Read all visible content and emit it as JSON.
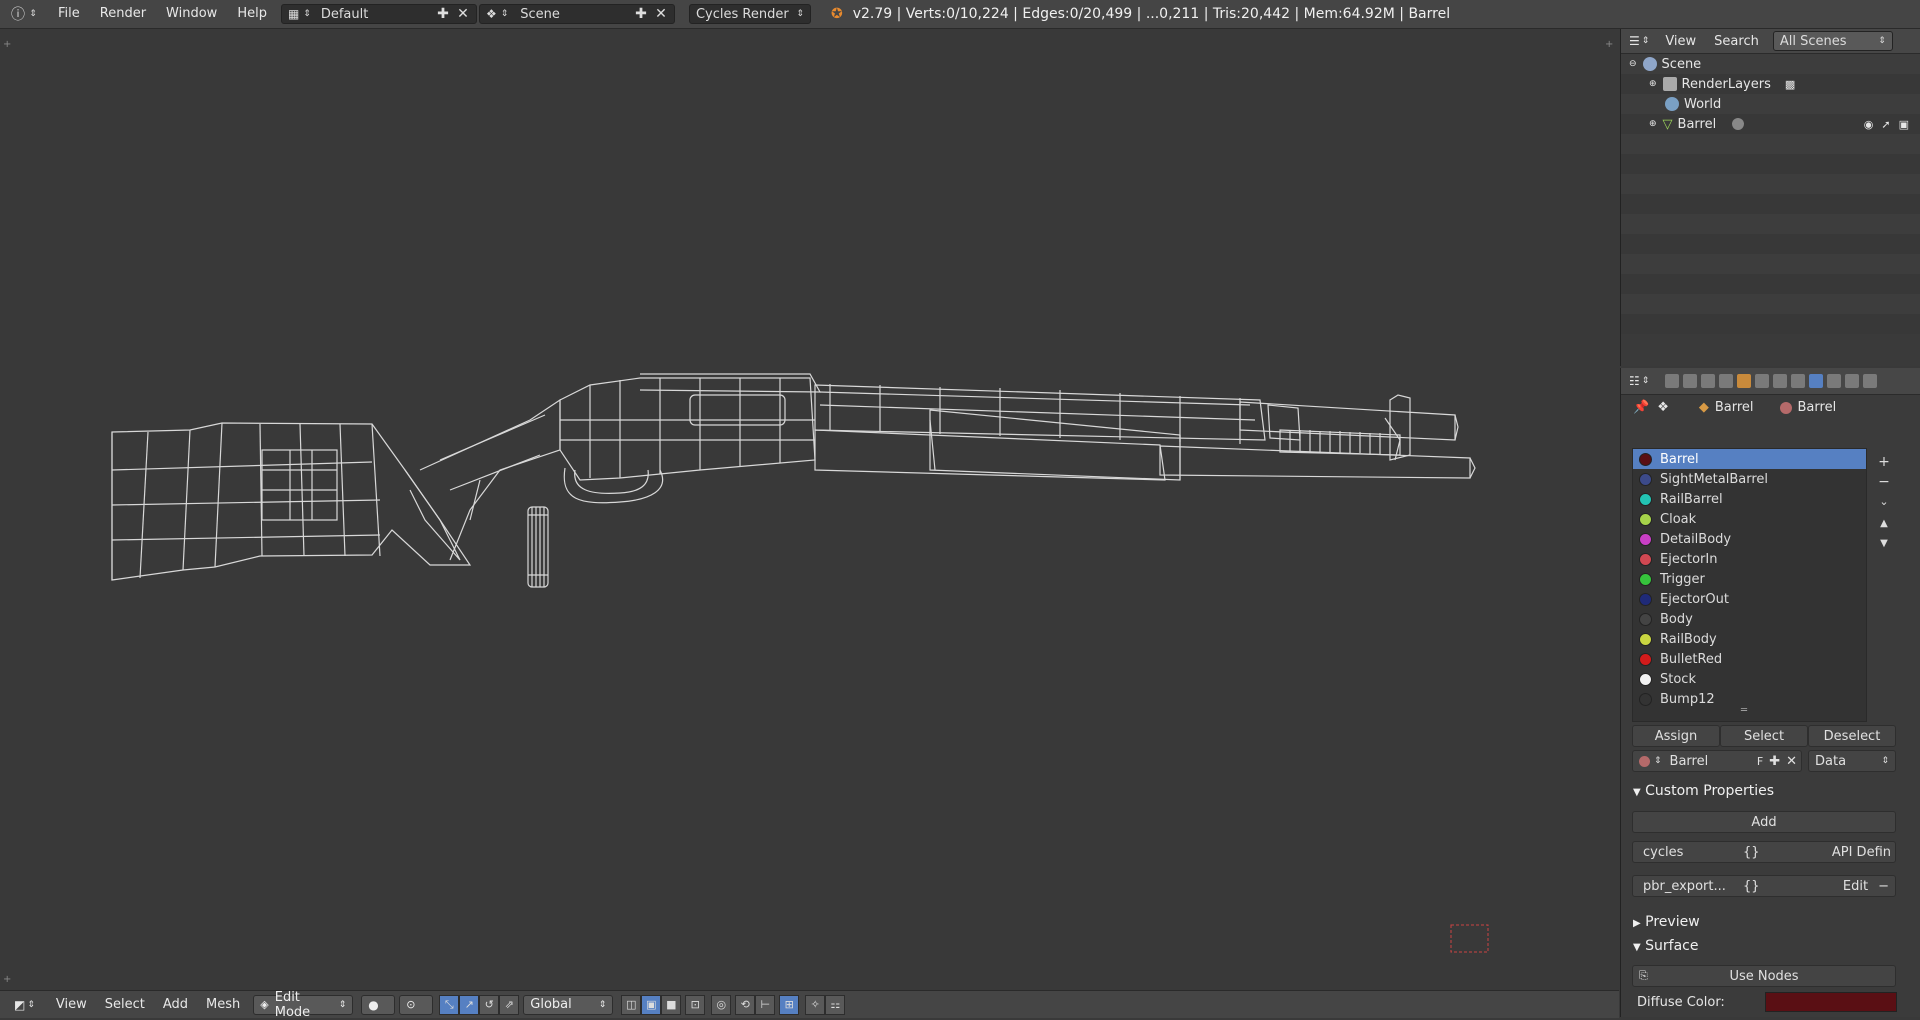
{
  "topbar": {
    "menus": [
      "File",
      "Render",
      "Window",
      "Help"
    ],
    "layout": "Default",
    "scene": "Scene",
    "engine": "Cycles Render",
    "stats": "v2.79 | Verts:0/10,224 | Edges:0/20,499 | ...0,211 | Tris:20,442 | Mem:64.92M | Barrel"
  },
  "bottombar": {
    "menus": [
      "View",
      "Select",
      "Add",
      "Mesh"
    ],
    "mode": "Edit Mode",
    "orientation": "Global"
  },
  "outliner": {
    "view_label": "View",
    "search_label": "Search",
    "filter": "All Scenes",
    "items": [
      {
        "label": "Scene"
      },
      {
        "label": "RenderLayers"
      },
      {
        "label": "World"
      },
      {
        "label": "Barrel"
      }
    ]
  },
  "properties": {
    "object_name": "Barrel",
    "material_name": "Barrel",
    "materials": [
      {
        "name": "Barrel",
        "color": "#5a0f14"
      },
      {
        "name": "SightMetalBarrel",
        "color": "#3c4a8a"
      },
      {
        "name": "RailBarrel",
        "color": "#23c4b4"
      },
      {
        "name": "Cloak",
        "color": "#a6d44a"
      },
      {
        "name": "DetailBody",
        "color": "#c93fc6"
      },
      {
        "name": "EjectorIn",
        "color": "#d14852"
      },
      {
        "name": "Trigger",
        "color": "#36c43c"
      },
      {
        "name": "EjectorOut",
        "color": "#1f2a78"
      },
      {
        "name": "Body",
        "color": "#444444"
      },
      {
        "name": "RailBody",
        "color": "#c9d641"
      },
      {
        "name": "BulletRed",
        "color": "#d31b1b"
      },
      {
        "name": "Stock",
        "color": "#f2f2f2"
      },
      {
        "name": "Bump12",
        "color": "#333333"
      }
    ],
    "assign": "Assign",
    "select": "Select",
    "deselect": "Deselect",
    "slot_material": "Barrel",
    "slot_fake": "F",
    "slot_link": "Data",
    "custom_props_title": "Custom Properties",
    "add_label": "Add",
    "custom_props": [
      {
        "name": "cycles",
        "value": "{}",
        "action": "API Defin"
      },
      {
        "name": "pbr_export...",
        "value": "{}",
        "action": "Edit"
      }
    ],
    "preview_title": "Preview",
    "surface_title": "Surface",
    "use_nodes": "Use Nodes",
    "diffuse_label": "Diffuse Color:",
    "diffuse_color": "#5a0f14"
  }
}
